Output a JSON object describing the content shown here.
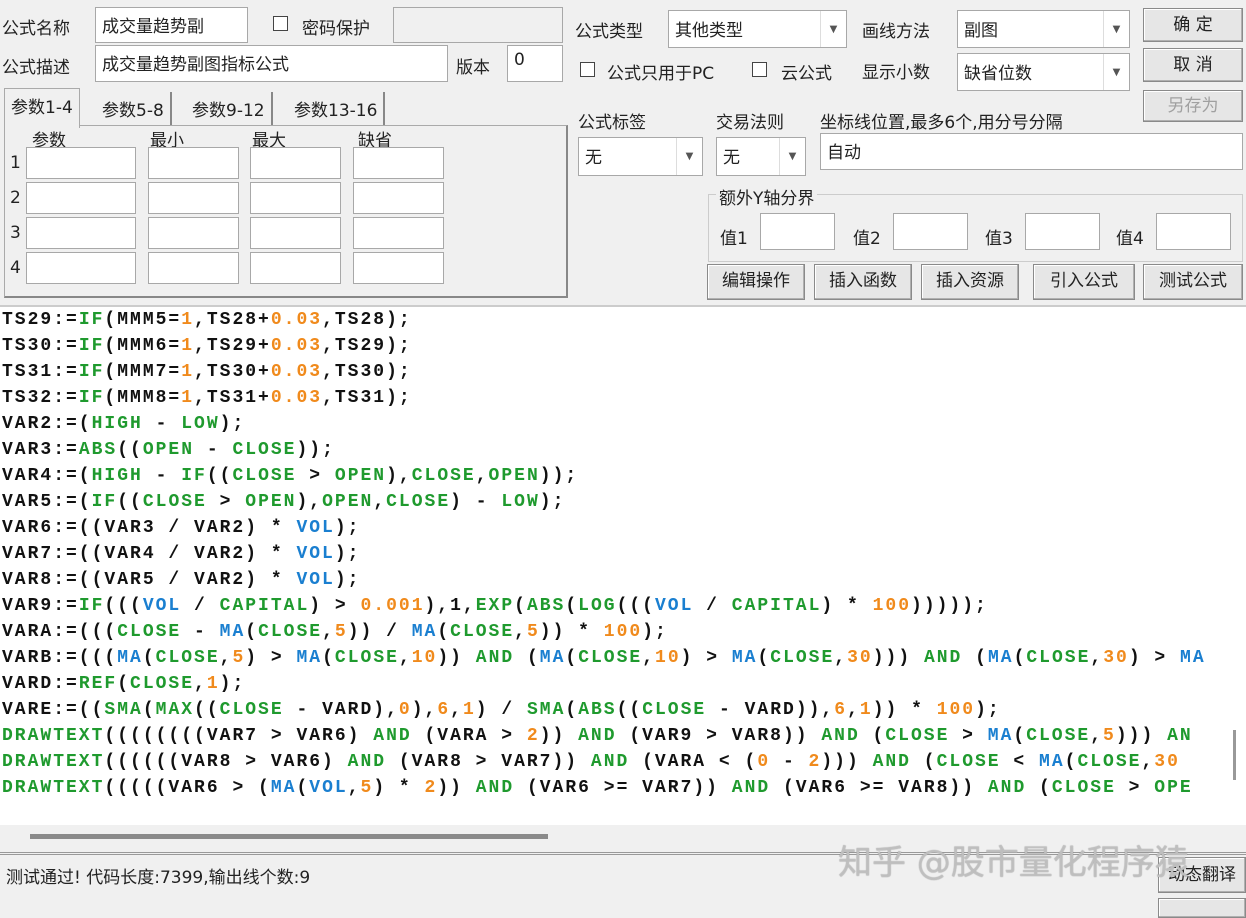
{
  "form": {
    "name_label": "公式名称",
    "name_value": "成交量趋势副",
    "password_label": "密码保护",
    "password_value": "",
    "desc_label": "公式描述",
    "desc_value": "成交量趋势副图指标公式",
    "version_label": "版本",
    "version_value": "0",
    "type_label": "公式类型",
    "type_value": "其他类型",
    "draw_label": "画线方法",
    "draw_value": "副图",
    "pc_only_label": "公式只用于PC",
    "cloud_label": "云公式",
    "decimal_label": "显示小数",
    "decimal_value": "缺省位数",
    "tag_label": "公式标签",
    "tag_value": "无",
    "rule_label": "交易法则",
    "rule_value": "无",
    "axis_label": "坐标线位置,最多6个,用分号分隔",
    "axis_value": "自动",
    "yaxis_group": "额外Y轴分界",
    "yvals": [
      {
        "label": "值1",
        "value": ""
      },
      {
        "label": "值2",
        "value": ""
      },
      {
        "label": "值3",
        "value": ""
      },
      {
        "label": "值4",
        "value": ""
      }
    ]
  },
  "buttons": {
    "ok": "确  定",
    "cancel": "取  消",
    "save_as": "另存为",
    "edit": "编辑操作",
    "insert_func": "插入函数",
    "insert_res": "插入资源",
    "import": "引入公式",
    "test": "测试公式",
    "dyn_translate": "动态翻译"
  },
  "tabs": [
    "参数1-4",
    "参数5-8",
    "参数9-12",
    "参数13-16"
  ],
  "params": {
    "headers": [
      "参数",
      "最小",
      "最大",
      "缺省"
    ],
    "rows": [
      "1",
      "2",
      "3",
      "4"
    ]
  },
  "code": [
    [
      [
        "k",
        "TS29:="
      ],
      [
        "g",
        "IF"
      ],
      [
        "k",
        "(MMM5="
      ],
      [
        "o",
        "1"
      ],
      [
        "k",
        ",TS28+"
      ],
      [
        "o",
        "0.03"
      ],
      [
        "k",
        ",TS28);"
      ]
    ],
    [
      [
        "k",
        "TS30:="
      ],
      [
        "g",
        "IF"
      ],
      [
        "k",
        "(MMM6="
      ],
      [
        "o",
        "1"
      ],
      [
        "k",
        ",TS29+"
      ],
      [
        "o",
        "0.03"
      ],
      [
        "k",
        ",TS29);"
      ]
    ],
    [
      [
        "k",
        "TS31:="
      ],
      [
        "g",
        "IF"
      ],
      [
        "k",
        "(MMM7="
      ],
      [
        "o",
        "1"
      ],
      [
        "k",
        ",TS30+"
      ],
      [
        "o",
        "0.03"
      ],
      [
        "k",
        ",TS30);"
      ]
    ],
    [
      [
        "k",
        "TS32:="
      ],
      [
        "g",
        "IF"
      ],
      [
        "k",
        "(MMM8="
      ],
      [
        "o",
        "1"
      ],
      [
        "k",
        ",TS31+"
      ],
      [
        "o",
        "0.03"
      ],
      [
        "k",
        ",TS31);"
      ]
    ],
    [
      [
        "k",
        "VAR2:=("
      ],
      [
        "g",
        "HIGH"
      ],
      [
        "k",
        " - "
      ],
      [
        "g",
        "LOW"
      ],
      [
        "k",
        ");"
      ]
    ],
    [
      [
        "k",
        "VAR3:="
      ],
      [
        "g",
        "ABS"
      ],
      [
        "k",
        "(("
      ],
      [
        "g",
        "OPEN"
      ],
      [
        "k",
        " - "
      ],
      [
        "g",
        "CLOSE"
      ],
      [
        "k",
        "));"
      ]
    ],
    [
      [
        "k",
        "VAR4:=("
      ],
      [
        "g",
        "HIGH"
      ],
      [
        "k",
        " - "
      ],
      [
        "g",
        "IF"
      ],
      [
        "k",
        "(("
      ],
      [
        "g",
        "CLOSE"
      ],
      [
        "k",
        " > "
      ],
      [
        "g",
        "OPEN"
      ],
      [
        "k",
        "),"
      ],
      [
        "g",
        "CLOSE"
      ],
      [
        "k",
        ","
      ],
      [
        "g",
        "OPEN"
      ],
      [
        "k",
        "));"
      ]
    ],
    [
      [
        "k",
        "VAR5:=("
      ],
      [
        "g",
        "IF"
      ],
      [
        "k",
        "(("
      ],
      [
        "g",
        "CLOSE"
      ],
      [
        "k",
        " > "
      ],
      [
        "g",
        "OPEN"
      ],
      [
        "k",
        "),"
      ],
      [
        "g",
        "OPEN"
      ],
      [
        "k",
        ","
      ],
      [
        "g",
        "CLOSE"
      ],
      [
        "k",
        ") - "
      ],
      [
        "g",
        "LOW"
      ],
      [
        "k",
        ");"
      ]
    ],
    [
      [
        "k",
        "VAR6:=((VAR3 / VAR2) * "
      ],
      [
        "b",
        "VOL"
      ],
      [
        "k",
        ");"
      ]
    ],
    [
      [
        "k",
        "VAR7:=((VAR4 / VAR2) * "
      ],
      [
        "b",
        "VOL"
      ],
      [
        "k",
        ");"
      ]
    ],
    [
      [
        "k",
        "VAR8:=((VAR5 / VAR2) * "
      ],
      [
        "b",
        "VOL"
      ],
      [
        "k",
        ");"
      ]
    ],
    [
      [
        "k",
        "VAR9:="
      ],
      [
        "g",
        "IF"
      ],
      [
        "k",
        "((("
      ],
      [
        "b",
        "VOL"
      ],
      [
        "k",
        " / "
      ],
      [
        "g",
        "CAPITAL"
      ],
      [
        "k",
        ") > "
      ],
      [
        "o",
        "0.001"
      ],
      [
        "k",
        "),1,"
      ],
      [
        "g",
        "EXP"
      ],
      [
        "k",
        "("
      ],
      [
        "g",
        "ABS"
      ],
      [
        "k",
        "("
      ],
      [
        "g",
        "LOG"
      ],
      [
        "k",
        "((("
      ],
      [
        "b",
        "VOL"
      ],
      [
        "k",
        " / "
      ],
      [
        "g",
        "CAPITAL"
      ],
      [
        "k",
        ") * "
      ],
      [
        "o",
        "100"
      ],
      [
        "k",
        ")))));"
      ]
    ],
    [
      [
        "k",
        "VARA:=((("
      ],
      [
        "g",
        "CLOSE"
      ],
      [
        "k",
        " - "
      ],
      [
        "b",
        "MA"
      ],
      [
        "k",
        "("
      ],
      [
        "g",
        "CLOSE"
      ],
      [
        "k",
        ","
      ],
      [
        "o",
        "5"
      ],
      [
        "k",
        ")) / "
      ],
      [
        "b",
        "MA"
      ],
      [
        "k",
        "("
      ],
      [
        "g",
        "CLOSE"
      ],
      [
        "k",
        ","
      ],
      [
        "o",
        "5"
      ],
      [
        "k",
        ")) * "
      ],
      [
        "o",
        "100"
      ],
      [
        "k",
        ");"
      ]
    ],
    [
      [
        "k",
        "VARB:=((("
      ],
      [
        "b",
        "MA"
      ],
      [
        "k",
        "("
      ],
      [
        "g",
        "CLOSE"
      ],
      [
        "k",
        ","
      ],
      [
        "o",
        "5"
      ],
      [
        "k",
        ") > "
      ],
      [
        "b",
        "MA"
      ],
      [
        "k",
        "("
      ],
      [
        "g",
        "CLOSE"
      ],
      [
        "k",
        ","
      ],
      [
        "o",
        "10"
      ],
      [
        "k",
        ")) "
      ],
      [
        "g",
        "AND"
      ],
      [
        "k",
        " ("
      ],
      [
        "b",
        "MA"
      ],
      [
        "k",
        "("
      ],
      [
        "g",
        "CLOSE"
      ],
      [
        "k",
        ","
      ],
      [
        "o",
        "10"
      ],
      [
        "k",
        ") > "
      ],
      [
        "b",
        "MA"
      ],
      [
        "k",
        "("
      ],
      [
        "g",
        "CLOSE"
      ],
      [
        "k",
        ","
      ],
      [
        "o",
        "30"
      ],
      [
        "k",
        "))) "
      ],
      [
        "g",
        "AND"
      ],
      [
        "k",
        " ("
      ],
      [
        "b",
        "MA"
      ],
      [
        "k",
        "("
      ],
      [
        "g",
        "CLOSE"
      ],
      [
        "k",
        ","
      ],
      [
        "o",
        "30"
      ],
      [
        "k",
        ") > "
      ],
      [
        "b",
        "MA"
      ]
    ],
    [
      [
        "k",
        "VARD:="
      ],
      [
        "g",
        "REF"
      ],
      [
        "k",
        "("
      ],
      [
        "g",
        "CLOSE"
      ],
      [
        "k",
        ","
      ],
      [
        "o",
        "1"
      ],
      [
        "k",
        ");"
      ]
    ],
    [
      [
        "k",
        "VARE:=(("
      ],
      [
        "g",
        "SMA"
      ],
      [
        "k",
        "("
      ],
      [
        "g",
        "MAX"
      ],
      [
        "k",
        "(("
      ],
      [
        "g",
        "CLOSE"
      ],
      [
        "k",
        " - VARD),"
      ],
      [
        "o",
        "0"
      ],
      [
        "k",
        "),"
      ],
      [
        "o",
        "6"
      ],
      [
        "k",
        ","
      ],
      [
        "o",
        "1"
      ],
      [
        "k",
        ") / "
      ],
      [
        "g",
        "SMA"
      ],
      [
        "k",
        "("
      ],
      [
        "g",
        "ABS"
      ],
      [
        "k",
        "(("
      ],
      [
        "g",
        "CLOSE"
      ],
      [
        "k",
        " - VARD)),"
      ],
      [
        "o",
        "6"
      ],
      [
        "k",
        ","
      ],
      [
        "o",
        "1"
      ],
      [
        "k",
        ")) * "
      ],
      [
        "o",
        "100"
      ],
      [
        "k",
        ");"
      ]
    ],
    [
      [
        "g",
        "DRAWTEXT"
      ],
      [
        "k",
        "((((((((VAR7 > VAR6) "
      ],
      [
        "g",
        "AND"
      ],
      [
        "k",
        " (VARA > "
      ],
      [
        "o",
        "2"
      ],
      [
        "k",
        ")) "
      ],
      [
        "g",
        "AND"
      ],
      [
        "k",
        " (VAR9 > VAR8)) "
      ],
      [
        "g",
        "AND"
      ],
      [
        "k",
        " ("
      ],
      [
        "g",
        "CLOSE"
      ],
      [
        "k",
        " > "
      ],
      [
        "b",
        "MA"
      ],
      [
        "k",
        "("
      ],
      [
        "g",
        "CLOSE"
      ],
      [
        "k",
        ","
      ],
      [
        "o",
        "5"
      ],
      [
        "k",
        "))) "
      ],
      [
        "g",
        "AN"
      ]
    ],
    [
      [
        "g",
        "DRAWTEXT"
      ],
      [
        "k",
        "((((((VAR8 > VAR6) "
      ],
      [
        "g",
        "AND"
      ],
      [
        "k",
        " (VAR8 > VAR7)) "
      ],
      [
        "g",
        "AND"
      ],
      [
        "k",
        " (VARA < ("
      ],
      [
        "o",
        "0"
      ],
      [
        "k",
        " - "
      ],
      [
        "o",
        "2"
      ],
      [
        "k",
        "))) "
      ],
      [
        "g",
        "AND"
      ],
      [
        "k",
        " ("
      ],
      [
        "g",
        "CLOSE"
      ],
      [
        "k",
        " < "
      ],
      [
        "b",
        "MA"
      ],
      [
        "k",
        "("
      ],
      [
        "g",
        "CLOSE"
      ],
      [
        "k",
        ","
      ],
      [
        "o",
        "30"
      ]
    ],
    [
      [
        "g",
        "DRAWTEXT"
      ],
      [
        "k",
        "(((((VAR6 > ("
      ],
      [
        "b",
        "MA"
      ],
      [
        "k",
        "("
      ],
      [
        "b",
        "VOL"
      ],
      [
        "k",
        ","
      ],
      [
        "o",
        "5"
      ],
      [
        "k",
        ") * "
      ],
      [
        "o",
        "2"
      ],
      [
        "k",
        ")) "
      ],
      [
        "g",
        "AND"
      ],
      [
        "k",
        " (VAR6 >= VAR7)) "
      ],
      [
        "g",
        "AND"
      ],
      [
        "k",
        " (VAR6 >= VAR8)) "
      ],
      [
        "g",
        "AND"
      ],
      [
        "k",
        " ("
      ],
      [
        "g",
        "CLOSE"
      ],
      [
        "k",
        " > "
      ],
      [
        "g",
        "OPE"
      ]
    ]
  ],
  "status": {
    "text": "测试通过! 代码长度:7399,输出线个数:9"
  },
  "watermark": "知乎 @股市量化程序猿"
}
